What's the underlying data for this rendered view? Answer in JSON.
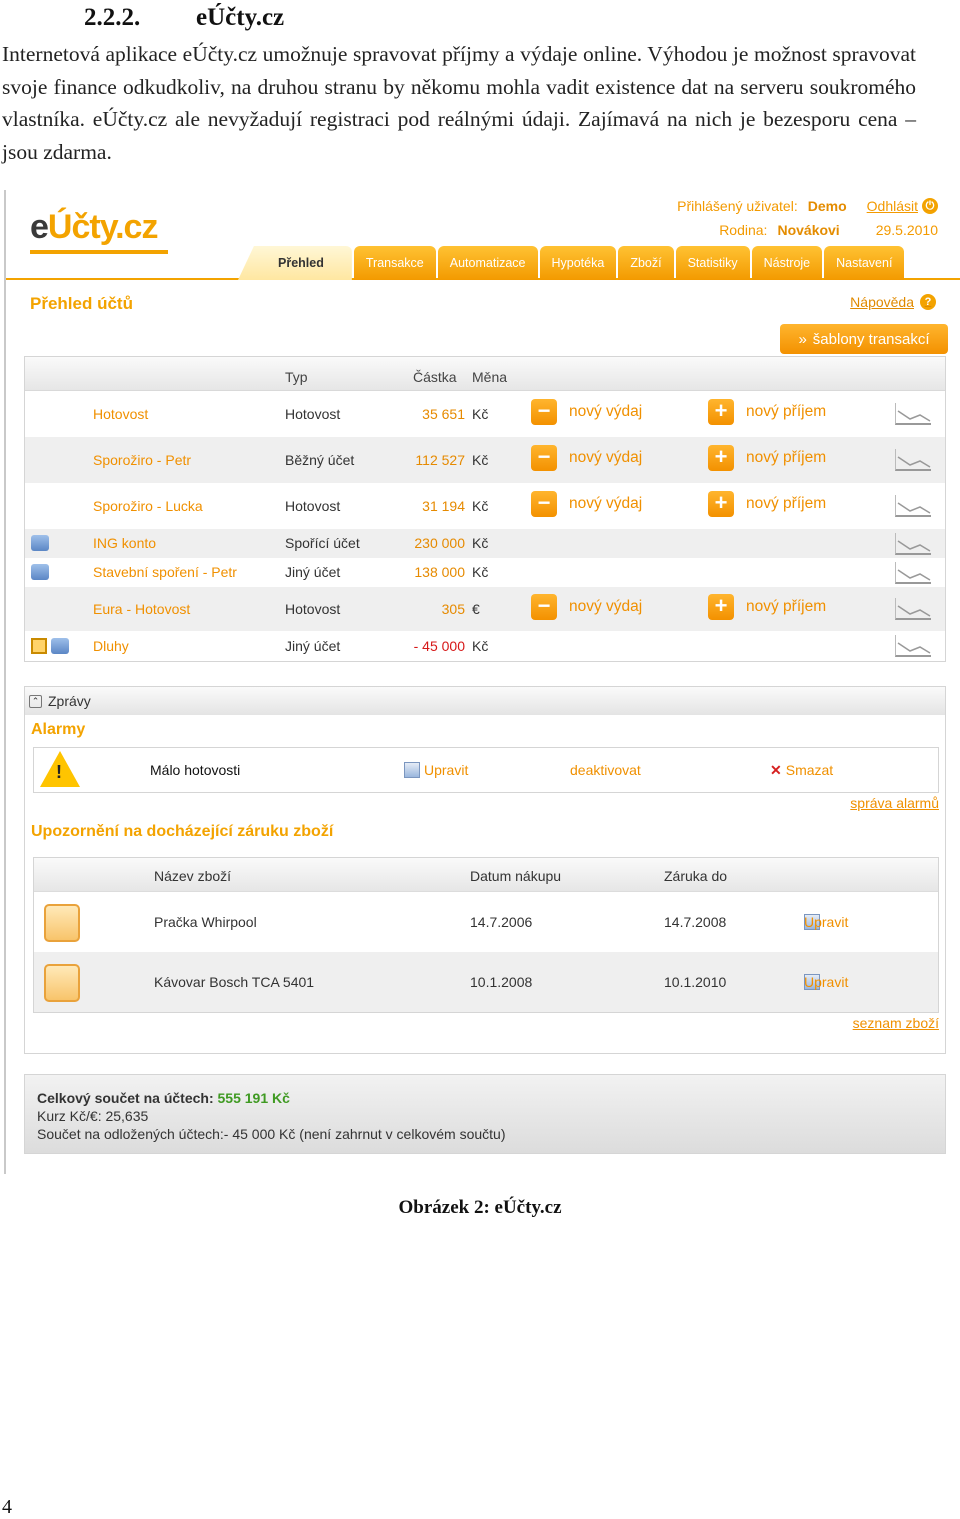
{
  "doc": {
    "heading_number": "2.2.2.",
    "heading_title": "eÚčty.cz",
    "paragraph": "Internetová aplikace eÚčty.cz umožnuje spravovat příjmy a výdaje online. Výhodou je možnost spravovat svoje finance odkudkoliv, na druhou stranu by někomu mohla vadit existence dat na serveru soukromého vlastníka. eÚčty.cz ale nevyžadují registraci pod reálnými údaji. Zajímavá na nich je bezesporu cena – jsou zdarma.",
    "caption": "Obrázek 2: eÚčty.cz",
    "page_number": "4"
  },
  "app": {
    "logo_e": "e",
    "logo_rest": "Účty.cz",
    "user_label": "Přihlášený uživatel:",
    "user_name": "Demo",
    "logout": "Odhlásit",
    "family_label": "Rodina:",
    "family_name": "Novákovi",
    "date": "29.5.2010",
    "tabs": [
      "Přehled",
      "Transakce",
      "Automatizace",
      "Hypotéka",
      "Zboží",
      "Statistiky",
      "Nástroje",
      "Nastavení"
    ],
    "section_title": "Přehled účtů",
    "help": "Nápověda",
    "templates_button": "šablony transakcí",
    "columns": {
      "type": "Typ",
      "amount": "Částka",
      "currency": "Měna"
    },
    "expense_label": "nový výdaj",
    "income_label": "nový příjem",
    "accounts": [
      {
        "name": "Hotovost",
        "type": "Hotovost",
        "amount": "35 651",
        "currency": "Kč"
      },
      {
        "name": "Sporožiro - Petr",
        "type": "Běžný účet",
        "amount": "112 527",
        "currency": "Kč"
      },
      {
        "name": "Sporožiro - Lucka",
        "type": "Hotovost",
        "amount": "31 194",
        "currency": "Kč"
      },
      {
        "name": "ING konto",
        "type": "Spořící účet",
        "amount": "230 000",
        "currency": "Kč"
      },
      {
        "name": "Stavební spoření - Petr",
        "type": "Jiný účet",
        "amount": "138 000",
        "currency": "Kč"
      },
      {
        "name": "Eura - Hotovost",
        "type": "Hotovost",
        "amount": "305",
        "currency": "€"
      },
      {
        "name": "Dluhy",
        "type": "Jiný účet",
        "amount": "- 45 000",
        "currency": "Kč"
      }
    ],
    "messages_title": "Zprávy",
    "alarms_title": "Alarmy",
    "alarm_text": "Málo hotovosti",
    "alarm_edit": "Upravit",
    "alarm_deactivate": "deaktivovat",
    "alarm_delete": "Smazat",
    "alarm_manage": "správa alarmů",
    "warranty_title": "Upozornění na docházející záruku zboží",
    "warranty_columns": {
      "name": "Název zboží",
      "bought": "Datum nákupu",
      "until": "Záruka do"
    },
    "warranty_rows": [
      {
        "name": "Pračka Whirpool",
        "bought": "14.7.2006",
        "until": "14.7.2008",
        "edit": "Upravit"
      },
      {
        "name": "Kávovar Bosch TCA 5401",
        "bought": "10.1.2008",
        "until": "10.1.2010",
        "edit": "Upravit"
      }
    ],
    "goods_list": "seznam zboží",
    "total_label": "Celkový součet na účtech:",
    "total_value": "555 191 Kč",
    "rate": "Kurz Kč/€: 25,635",
    "deferred": "Součet na odložených účtech:- 45 000 Kč (není zahrnut v celkovém součtu)"
  }
}
